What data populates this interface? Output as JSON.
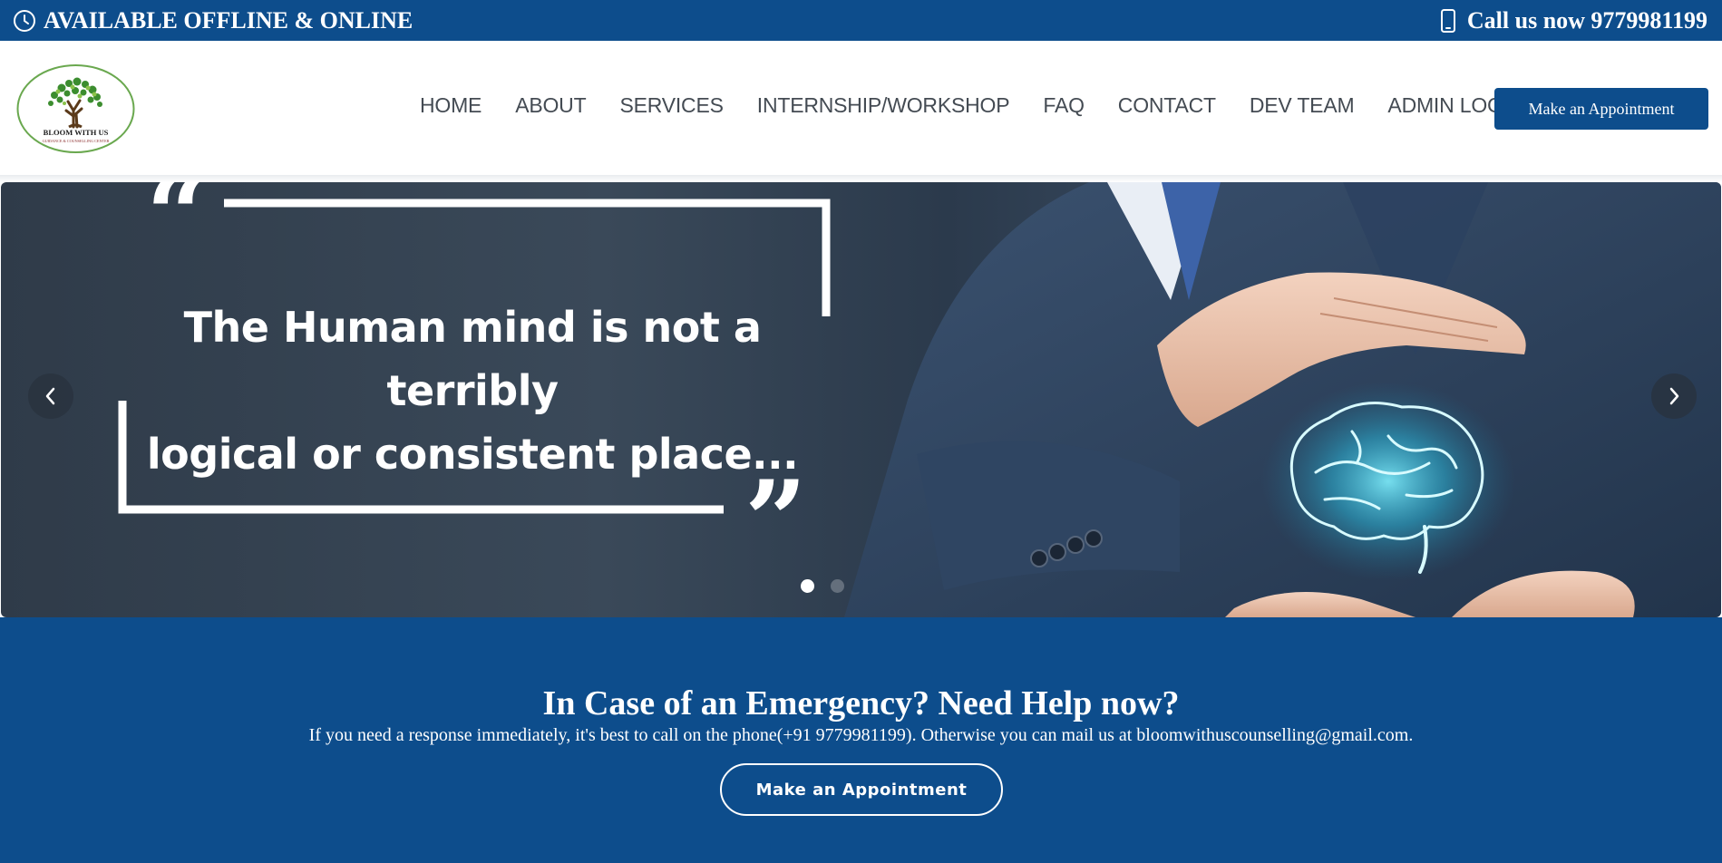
{
  "topbar": {
    "availability": "AVAILABLE OFFLINE & ONLINE",
    "call": "Call us now 9779981199",
    "icons": {
      "left": "clock-icon",
      "right": "phone-icon"
    }
  },
  "logo": {
    "title": "BLOOM WITH US",
    "subtitle": "GUIDANCE & COUNSELLING CENTER"
  },
  "nav": {
    "items": [
      {
        "label": "HOME"
      },
      {
        "label": "ABOUT"
      },
      {
        "label": "SERVICES"
      },
      {
        "label": "INTERNSHIP/WORKSHOP"
      },
      {
        "label": "FAQ"
      },
      {
        "label": "CONTACT"
      },
      {
        "label": "DEV TEAM"
      },
      {
        "label": "ADMIN LOGIN"
      }
    ],
    "cta": "Make an Appointment"
  },
  "hero": {
    "quote": "The Human mind is not a terribly logical or consistent place...",
    "quote_line1": "The Human mind is not a terribly",
    "quote_line2": "logical or consistent place...",
    "slides": 2,
    "active_slide": 1,
    "icons": {
      "prev": "chevron-left-icon",
      "next": "chevron-right-icon"
    }
  },
  "emergency": {
    "title": "In Case of an Emergency? Need Help now?",
    "text": "If you need a response immediately, it's best to call on the phone(+91 9779981199). Otherwise you can mail us at bloomwithuscounselling@gmail.com.",
    "button": "Make an Appointment"
  },
  "colors": {
    "brand": "#0d4d8c",
    "nav_text": "#444b53",
    "brain_glow": "#3fd4f0"
  }
}
